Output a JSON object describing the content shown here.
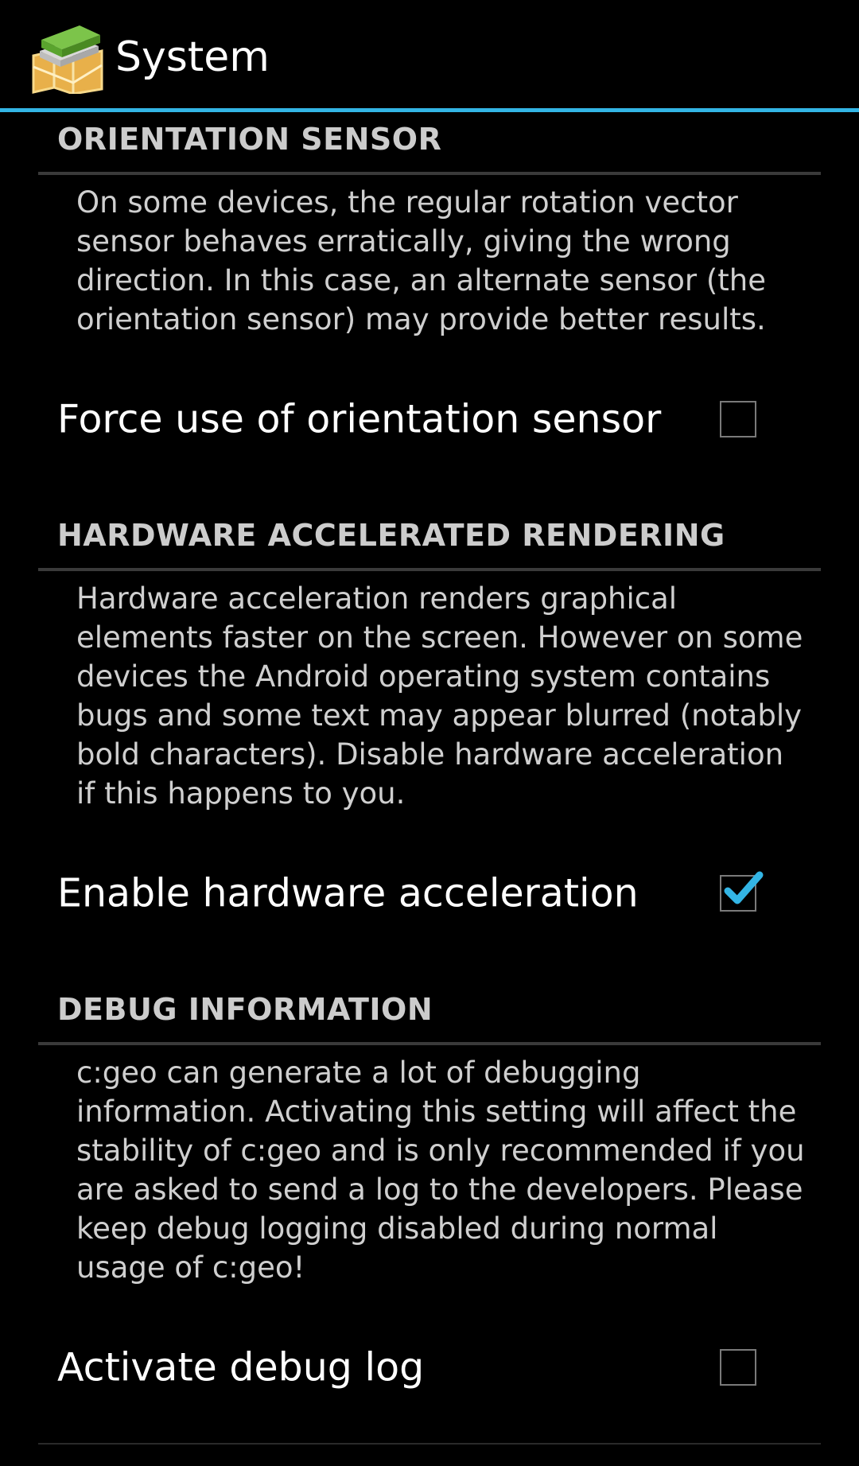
{
  "action_bar": {
    "title": "System",
    "icon": "cgeo-app-icon",
    "accent_color": "#33b5e5"
  },
  "sections": [
    {
      "header": "ORIENTATION SENSOR",
      "description": "On some devices, the regular rotation vector sensor behaves erratically, giving the wrong direction. In this case, an alternate sensor (the orientation sensor) may provide better results.",
      "pref_title": "Force use of orientation sensor",
      "checked": false
    },
    {
      "header": "HARDWARE ACCELERATED RENDERING",
      "description": "Hardware acceleration renders graphical elements faster on the screen. However on some devices the Android operating system contains bugs and some text may appear blurred (notably bold characters). Disable hardware acceleration if this happens to you.",
      "pref_title": "Enable hardware acceleration",
      "checked": true
    },
    {
      "header": "DEBUG INFORMATION",
      "description": "c:geo can generate a lot of debugging information. Activating this setting will affect the stability of c:geo and is only recommended if you are asked to send a log to the developers. Please keep debug logging disabled during normal usage of c:geo!",
      "pref_title": "Activate debug log",
      "checked": false
    }
  ]
}
